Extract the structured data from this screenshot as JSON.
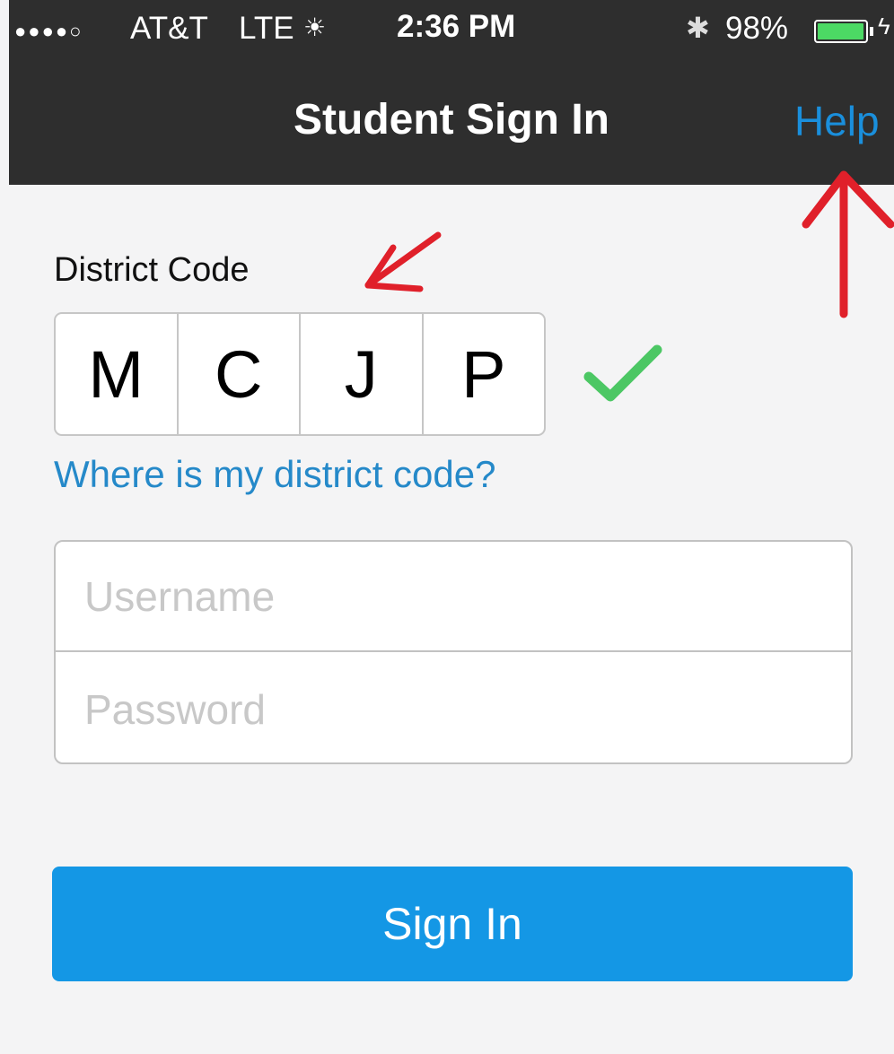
{
  "status_bar": {
    "signal": "●●●●○",
    "carrier": "AT&T",
    "network": "LTE",
    "activity": "☀",
    "time": "2:36 PM",
    "bluetooth": "✱",
    "battery_percent": "98%",
    "battery_level": 0.98,
    "charging": "ϟ"
  },
  "nav": {
    "title": "Student Sign In",
    "help": "Help"
  },
  "district": {
    "label": "District Code",
    "code": [
      "M",
      "C",
      "J",
      "P"
    ],
    "link": "Where is my district code?"
  },
  "form": {
    "username_placeholder": "Username",
    "password_placeholder": "Password",
    "signin_label": "Sign In"
  },
  "colors": {
    "accent": "#1497e5",
    "link": "#2589c9",
    "check": "#4cc764",
    "annotation": "#e0202a",
    "navbar": "#2e2e2e"
  }
}
